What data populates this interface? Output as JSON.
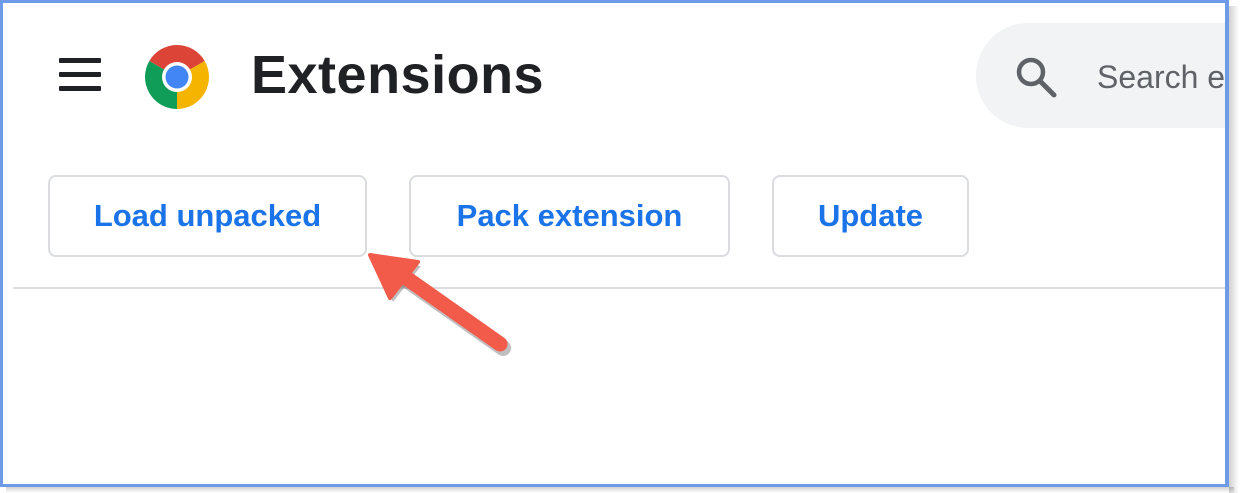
{
  "header": {
    "menu_icon": "hamburger-menu-icon",
    "logo_icon": "chrome-logo-icon",
    "title": "Extensions",
    "search": {
      "icon": "search-icon",
      "placeholder": "Search e"
    }
  },
  "toolbar": {
    "load_unpacked_label": "Load unpacked",
    "pack_extension_label": "Pack extension",
    "update_label": "Update"
  },
  "annotation": {
    "arrow_color": "#f25a4a",
    "points_to": "Load unpacked"
  },
  "colors": {
    "accent": "#1a73e8",
    "frame_border": "#6e9be8",
    "title_text": "#202124",
    "search_bg": "#f1f3f4"
  }
}
